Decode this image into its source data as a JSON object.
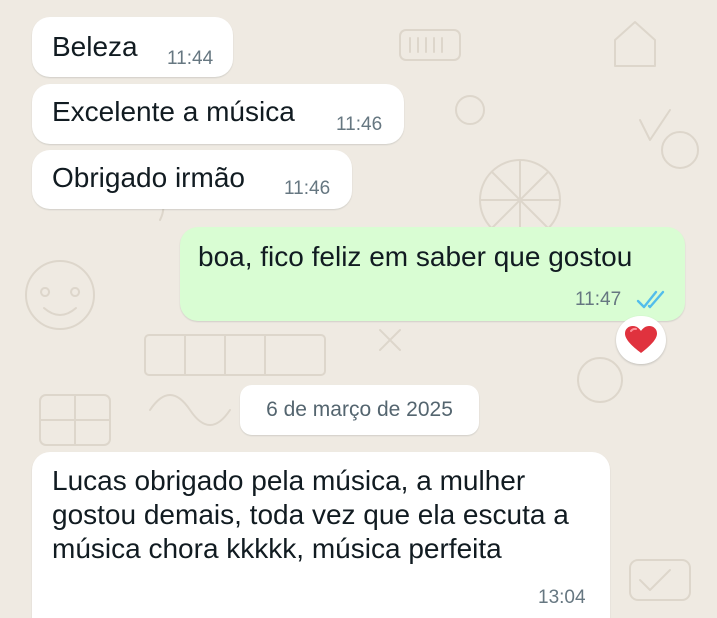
{
  "messages": [
    {
      "direction": "incoming",
      "text": "Beleza",
      "time": "11:44"
    },
    {
      "direction": "incoming",
      "text": "Excelente a música",
      "time": "11:46"
    },
    {
      "direction": "incoming",
      "text": "Obrigado irmão",
      "time": "11:46"
    },
    {
      "direction": "outgoing",
      "text": "boa, fico feliz em saber que gostou",
      "time": "11:47",
      "status_icon": "double-check-read-icon",
      "reaction": "heart"
    },
    {
      "direction": "incoming",
      "text": "Lucas obrigado pela música, a mulher gostou demais, toda vez que ela escuta a música chora kkkkk, música perfeita",
      "time": "13:04"
    }
  ],
  "date_divider": "6 de março de 2025",
  "colors": {
    "background": "#efeae2",
    "incoming_bubble": "#ffffff",
    "outgoing_bubble": "#d9fdd3",
    "read_ticks": "#53bdeb",
    "reaction_heart": "#e0323e"
  }
}
